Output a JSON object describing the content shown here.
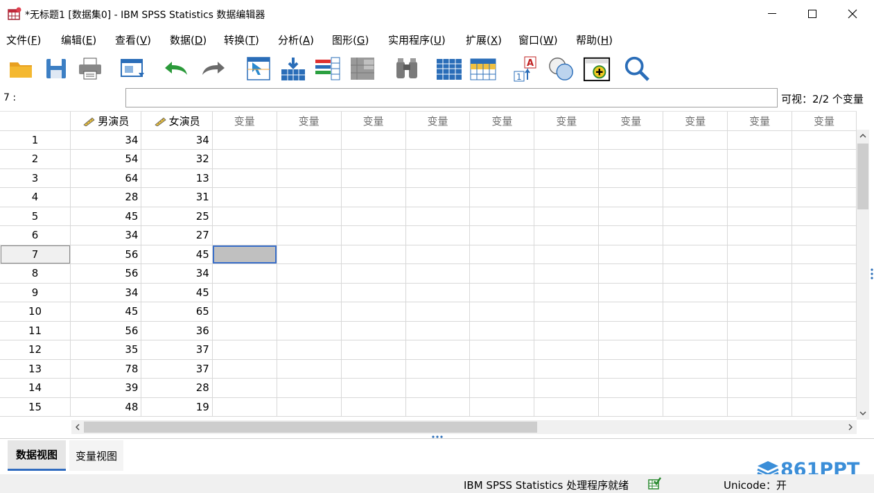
{
  "window": {
    "title": "*无标题1 [数据集0] - IBM SPSS Statistics 数据编辑器",
    "minimize": "—",
    "maximize": "☐",
    "close": "✕"
  },
  "menu": [
    {
      "label": "文件(",
      "key": "F",
      "tail": ")"
    },
    {
      "label": "编辑(",
      "key": "E",
      "tail": ")"
    },
    {
      "label": "查看(",
      "key": "V",
      "tail": ")"
    },
    {
      "label": "数据(",
      "key": "D",
      "tail": ")"
    },
    {
      "label": "转换(",
      "key": "T",
      "tail": ")"
    },
    {
      "label": "分析(",
      "key": "A",
      "tail": ")"
    },
    {
      "label": "图形(",
      "key": "G",
      "tail": ")"
    },
    {
      "label": "实用程序(",
      "key": "U",
      "tail": ")"
    },
    {
      "label": "扩展(",
      "key": "X",
      "tail": ")"
    },
    {
      "label": "窗口(",
      "key": "W",
      "tail": ")"
    },
    {
      "label": "帮助(",
      "key": "H",
      "tail": ")"
    }
  ],
  "toolbar": {
    "icons": [
      "open-folder-icon",
      "save-icon",
      "print-icon",
      "dialog-recall-icon",
      "undo-icon",
      "redo-icon",
      "goto-case-icon",
      "goto-variable-icon",
      "variables-icon",
      "run-descriptives-icon",
      "find-icon",
      "insert-cases-icon",
      "insert-variable-icon",
      "split-file-icon",
      "weight-cases-icon",
      "select-cases-icon",
      "value-labels-icon",
      "use-sets-icon",
      "search-icon"
    ]
  },
  "editor": {
    "cell_ref": "7 :",
    "cell_value": "",
    "visible_vars": "可视：2/2 个变量"
  },
  "grid": {
    "named_columns": [
      "男演员",
      "女演员"
    ],
    "empty_column_label": "变量",
    "empty_columns": [
      "变量",
      "变量",
      "变量",
      "变量",
      "变量",
      "变量",
      "变量",
      "变量",
      "变量",
      "变量"
    ],
    "selected_row": 7,
    "rows": [
      {
        "n": "1",
        "a": "34",
        "b": "34"
      },
      {
        "n": "2",
        "a": "54",
        "b": "32"
      },
      {
        "n": "3",
        "a": "64",
        "b": "13"
      },
      {
        "n": "4",
        "a": "28",
        "b": "31"
      },
      {
        "n": "5",
        "a": "45",
        "b": "25"
      },
      {
        "n": "6",
        "a": "34",
        "b": "27"
      },
      {
        "n": "7",
        "a": "56",
        "b": "45"
      },
      {
        "n": "8",
        "a": "56",
        "b": "34"
      },
      {
        "n": "9",
        "a": "34",
        "b": "45"
      },
      {
        "n": "10",
        "a": "45",
        "b": "65"
      },
      {
        "n": "11",
        "a": "56",
        "b": "36"
      },
      {
        "n": "12",
        "a": "35",
        "b": "37"
      },
      {
        "n": "13",
        "a": "78",
        "b": "37"
      },
      {
        "n": "14",
        "a": "39",
        "b": "28"
      },
      {
        "n": "15",
        "a": "48",
        "b": "19"
      }
    ]
  },
  "tabs": {
    "data_view": "数据视图",
    "variable_view": "变量视图"
  },
  "status": {
    "processor": "IBM SPSS Statistics 处理程序就绪",
    "unicode": "Unicode：开"
  },
  "watermark": "861PPT",
  "colors": {
    "selection_border": "#3a6fc9",
    "selection_fill": "#c0c0c0",
    "tab_accent": "#2f6bbf",
    "watermark": "#3b8ed8"
  }
}
